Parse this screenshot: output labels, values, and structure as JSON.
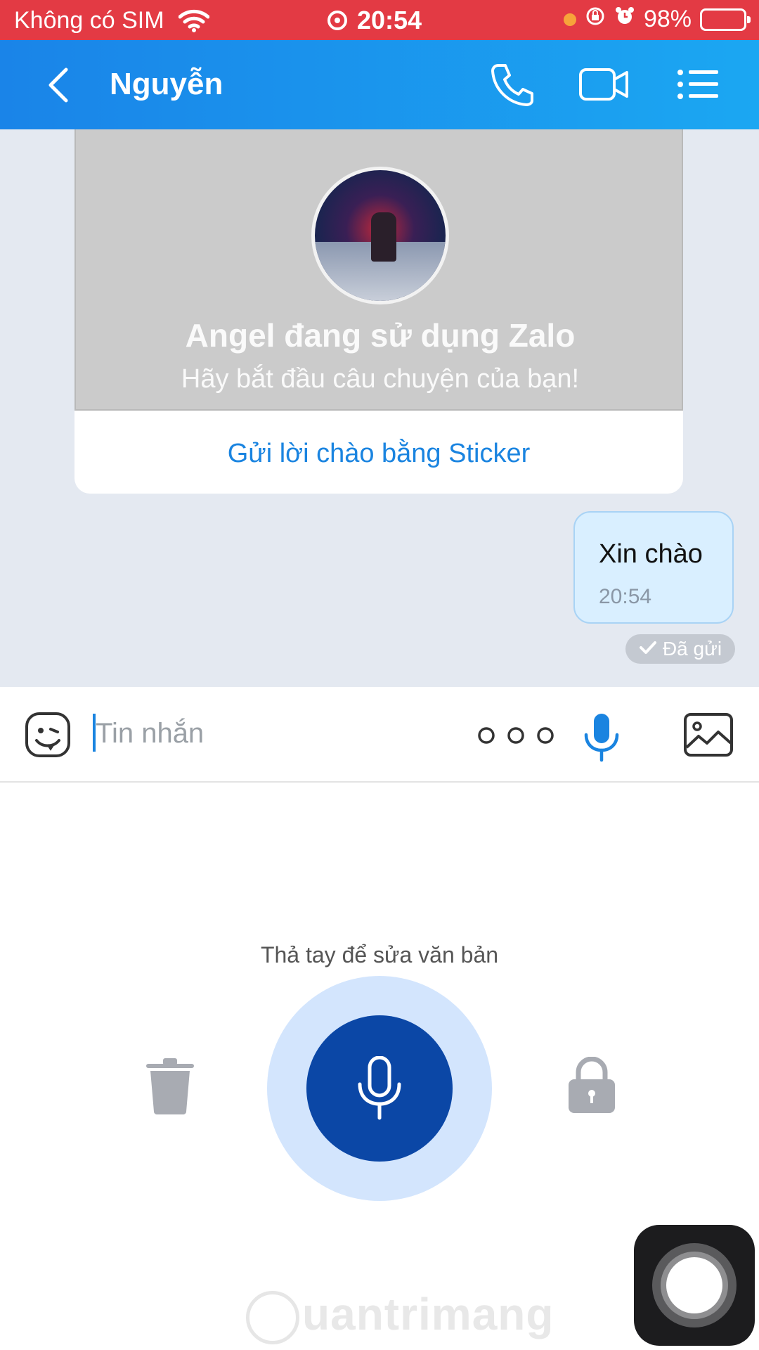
{
  "status_bar": {
    "carrier": "Không có SIM",
    "time": "20:54",
    "battery": "98%",
    "icons": [
      "wifi-icon",
      "screen-record-icon",
      "orange-dot",
      "rotation-lock-icon",
      "alarm-icon",
      "battery-icon"
    ]
  },
  "header": {
    "title": "Nguyễn",
    "icons": [
      "back-chevron-icon",
      "phone-icon",
      "video-camera-icon",
      "list-menu-icon"
    ]
  },
  "intro_card": {
    "title": "Angel đang sử dụng Zalo",
    "subtitle": "Hãy bắt đầu câu chuyện của bạn!",
    "sticker_link": "Gửi lời chào bằng Sticker"
  },
  "messages": [
    {
      "text": "Xin chào",
      "time": "20:54",
      "status": "Đã gửi"
    }
  ],
  "input": {
    "placeholder": "Tin nhắn",
    "icons": [
      "emoji-face-icon",
      "more-dots-icon",
      "microphone-icon",
      "image-icon"
    ]
  },
  "voice_panel": {
    "hint": "Thả tay để sửa văn bản",
    "icons": [
      "trash-icon",
      "microphone-icon",
      "lock-icon"
    ]
  },
  "watermark": "uantrimang",
  "colors": {
    "status_bar": "#e33a44",
    "header_start": "#1a84e8",
    "header_end": "#1ba7f2",
    "chat_bg": "#e4e9f1",
    "bubble": "#d9efff",
    "mic_button": "#0b47a6",
    "mic_ring": "#d3e5fd",
    "link": "#1a84e0"
  }
}
